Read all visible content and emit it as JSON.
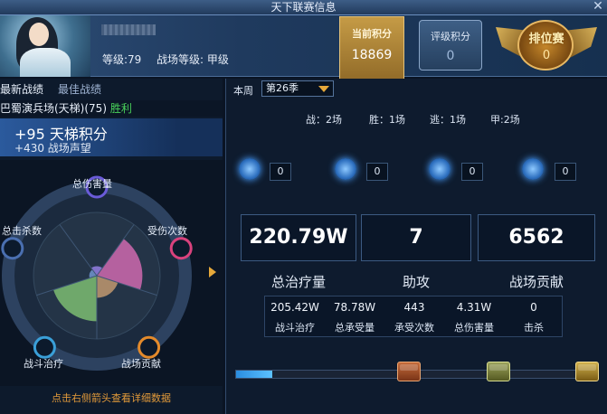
{
  "window": {
    "title": "天下联赛信息",
    "close_glyph": "✕"
  },
  "player": {
    "level": "等级:79",
    "arena_level": "战场等级: 甲级"
  },
  "badges": {
    "current_points": {
      "label": "当前积分",
      "value": "18869"
    },
    "rated_points": {
      "label": "评级积分",
      "value": "0"
    },
    "ranking": {
      "label": "排位赛",
      "value": "0"
    }
  },
  "left_panel": {
    "tabs": [
      "最新战绩",
      "最佳战绩"
    ],
    "match": {
      "name": "巴蜀演兵场(天梯)(75)",
      "result": "胜利"
    },
    "ladder_points": "+95 天梯积分",
    "arena_prestige": "+430 战场声望",
    "radar": {
      "axes": [
        "总伤害量",
        "受伤次数",
        "战场贡献",
        "战斗治疗",
        "总击杀数"
      ],
      "values": [
        0.15,
        0.72,
        0.35,
        0.72,
        0.12
      ]
    },
    "hint": "点击右侧箭头查看详细数据"
  },
  "right_panel": {
    "week_label": "本周",
    "season": "第26季",
    "record": [
      "战：2场",
      "胜：1场",
      "逃：1场",
      "甲:2场"
    ],
    "medals": [
      {
        "icon": "crossed-swords-icon",
        "count": "0"
      },
      {
        "icon": "dragon-icon",
        "count": "0"
      },
      {
        "icon": "warrior-icon",
        "count": "0"
      },
      {
        "icon": "handshake-icon",
        "count": "0"
      }
    ],
    "big_stats": [
      {
        "value": "220.79W",
        "caption": "总治疗量"
      },
      {
        "value": "7",
        "caption": "助攻"
      },
      {
        "value": "6562",
        "caption": "战场贡献"
      }
    ],
    "details": [
      {
        "value": "205.42W",
        "label": "战斗治疗"
      },
      {
        "value": "78.78W",
        "label": "总承受量"
      },
      {
        "value": "443",
        "label": "承受次数"
      },
      {
        "value": "4.31W",
        "label": "总伤害量"
      },
      {
        "value": "0",
        "label": "击杀"
      }
    ],
    "progress": 0.1
  },
  "colors": {
    "win": "#49d35a",
    "accent": "#e6a83a",
    "hint": "#e29a3a"
  }
}
